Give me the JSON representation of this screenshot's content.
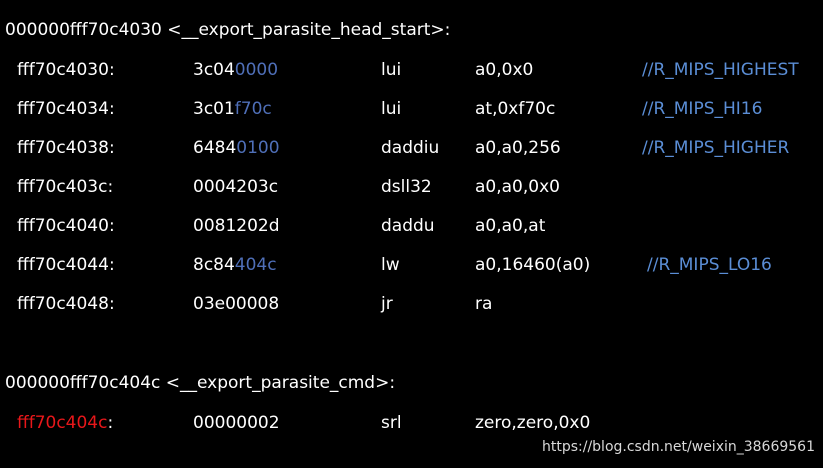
{
  "colors": {
    "background": "#000000",
    "text": "#ffffff",
    "relocation_hex": "#4f6fb8",
    "comment": "#5b8ed6",
    "highlight": "#e8171a"
  },
  "sections": [
    {
      "label": "000000fff70c4030 <__export_parasite_head_start>:",
      "rows": [
        {
          "addr": "fff70c4030:",
          "hex_plain": "3c04",
          "hex_blue": "0000",
          "mnemonic": "lui",
          "operands": "a0,0x0",
          "comment": "//R_MIPS_HIGHEST"
        },
        {
          "addr": "fff70c4034:",
          "hex_plain": "3c01",
          "hex_blue": "f70c",
          "mnemonic": "lui",
          "operands": "at,0xf70c",
          "comment": "//R_MIPS_HI16"
        },
        {
          "addr": "fff70c4038:",
          "hex_plain": "6484",
          "hex_blue": "0100",
          "mnemonic": "daddiu",
          "operands": "a0,a0,256",
          "comment": "//R_MIPS_HIGHER"
        },
        {
          "addr": "fff70c403c:",
          "hex_plain": "0004203c",
          "hex_blue": "",
          "mnemonic": "dsll32",
          "operands": "a0,a0,0x0",
          "comment": ""
        },
        {
          "addr": "fff70c4040:",
          "hex_plain": "0081202d",
          "hex_blue": "",
          "mnemonic": "daddu",
          "operands": "a0,a0,at",
          "comment": ""
        },
        {
          "addr": "fff70c4044:",
          "hex_plain": "8c84",
          "hex_blue": "404c",
          "mnemonic": "lw",
          "operands": "a0,16460(a0)",
          "comment": "//R_MIPS_LO16"
        },
        {
          "addr": "fff70c4048:",
          "hex_plain": "03e00008",
          "hex_blue": "",
          "mnemonic": "jr",
          "operands": "ra",
          "comment": ""
        }
      ]
    },
    {
      "label": "000000fff70c404c <__export_parasite_cmd>:",
      "rows": [
        {
          "addr_red": "fff70c404c",
          "addr_suffix": ":",
          "hex_plain": "00000002",
          "hex_blue": "",
          "mnemonic": "srl",
          "operands": "zero,zero,0x0",
          "comment": ""
        }
      ]
    }
  ],
  "watermark": "https://blog.csdn.net/weixin_38669561"
}
